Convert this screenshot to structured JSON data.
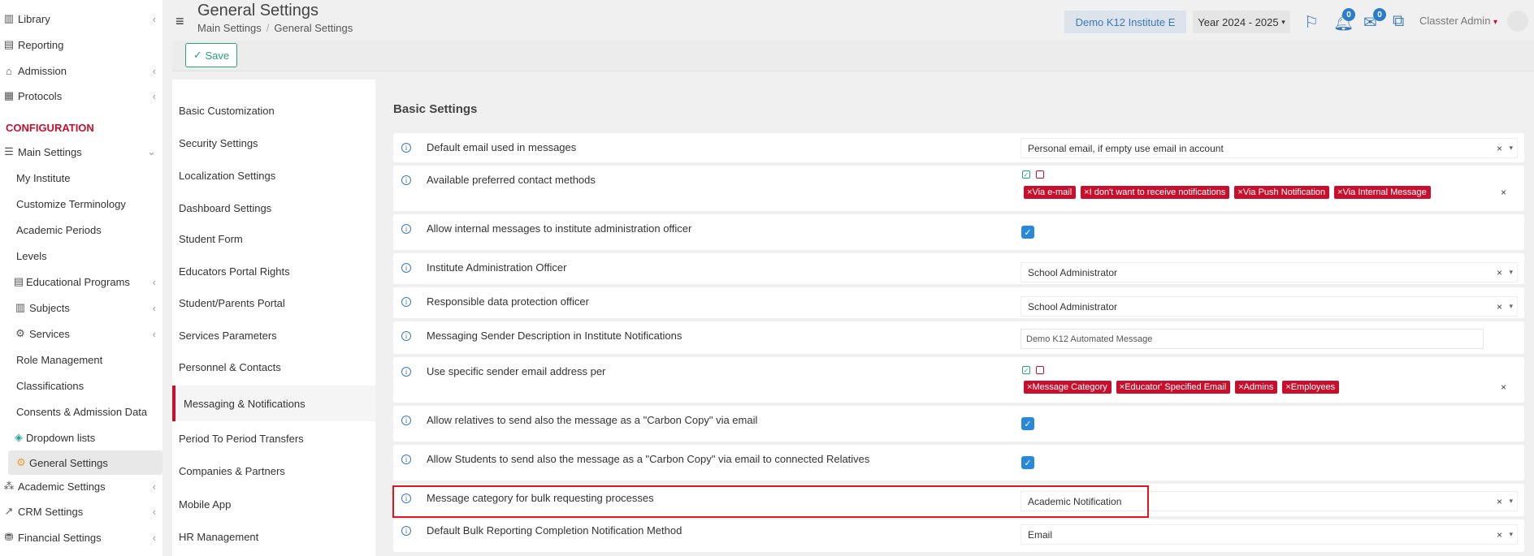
{
  "sidebar": {
    "top_items": [
      {
        "label": "Library",
        "icon": "library-icon"
      },
      {
        "label": "Reporting",
        "icon": "printer-icon"
      },
      {
        "label": "Admission",
        "icon": "institution-icon"
      },
      {
        "label": "Protocols",
        "icon": "protocols-icon"
      }
    ],
    "section_header": "CONFIGURATION",
    "main_settings": "Main Settings",
    "sub_items": [
      "My Institute",
      "Customize Terminology",
      "Academic Periods",
      "Levels",
      "Educational Programs",
      "Subjects",
      "Services",
      "Role Management",
      "Classifications",
      "Consents & Admission Data",
      "Dropdown lists",
      "General Settings"
    ],
    "bottom_items": [
      "Academic Settings",
      "CRM Settings",
      "Financial Settings"
    ]
  },
  "header": {
    "title": "General Settings",
    "breadcrumb": [
      "Main Settings",
      "General Settings"
    ],
    "institute": "Demo K12 Institute E",
    "year": "Year 2024 - 2025",
    "notifications_count": "0",
    "messages_count": "0",
    "user": "Classter Admin"
  },
  "toolbar": {
    "save_label": "Save"
  },
  "menu": [
    "Basic Customization",
    "Security Settings",
    "Localization Settings",
    "Dashboard Settings",
    "Student Form",
    "Educators Portal Rights",
    "Student/Parents Portal",
    "Services Parameters",
    "Personnel & Contacts",
    "Messaging & Notifications",
    "Period To Period Transfers",
    "Companies & Partners",
    "Mobile App",
    "HR Management"
  ],
  "main": {
    "section_title": "Basic Settings",
    "rows": [
      {
        "label": "Default email used in messages",
        "value": "Personal email, if empty use email in account"
      },
      {
        "label": "Available preferred contact methods",
        "tags": [
          "Via e-mail",
          "I don't want to receive notifications",
          "Via Push Notification",
          "Via Internal Message"
        ]
      },
      {
        "label": "Allow internal messages to institute administration officer"
      },
      {
        "label": "Institute Administration Officer",
        "value": "School Administrator"
      },
      {
        "label": "Responsible data protection officer",
        "value": "School Administrator"
      },
      {
        "label": "Messaging Sender Description in Institute Notifications",
        "value": "Demo K12 Automated Message"
      },
      {
        "label": "Use specific sender email address per",
        "tags": [
          "Message Category",
          "Educator' Specified Email",
          "Admins",
          "Employees"
        ]
      },
      {
        "label": "Allow relatives to send also the message as a \"Carbon Copy\" via email"
      },
      {
        "label": "Allow Students to send also the message as a \"Carbon Copy\" via email to connected Relatives"
      },
      {
        "label": "Message category for bulk requesting processes",
        "value": "Academic Notification"
      },
      {
        "label": "Default Bulk Reporting Completion Notification Method",
        "value": "Email"
      }
    ]
  },
  "glyphs": {
    "chevron_left": "‹",
    "chevron_down": "⌄",
    "clear": "×",
    "caret": "▾",
    "check": "✓",
    "info": "i",
    "tag_x": "×",
    "hamburger": "≡",
    "breadcrumb_sep": "/"
  }
}
